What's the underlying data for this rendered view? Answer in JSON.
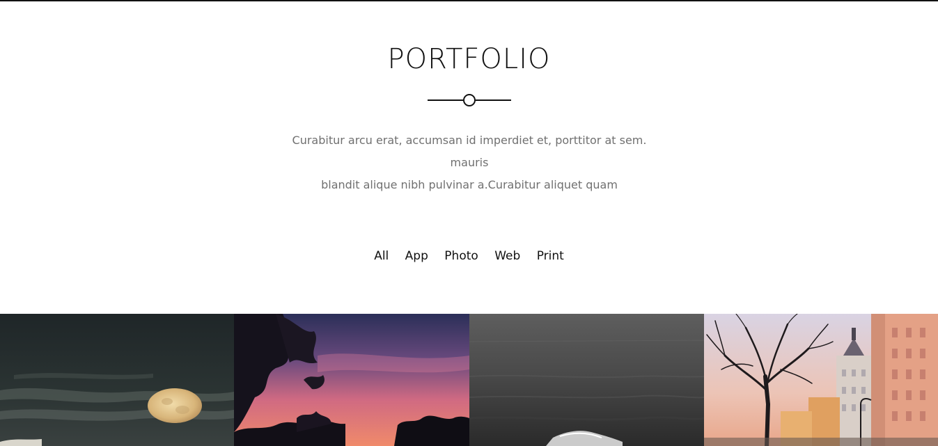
{
  "section": {
    "title": "PORTFOLIO",
    "description_line1": "Curabitur arcu erat, accumsan id imperdiet et, porttitor at sem. mauris",
    "description_line2": "blandit alique nibh pulvinar a.Curabitur aliquet quam"
  },
  "filters": [
    {
      "label": "All"
    },
    {
      "label": "App"
    },
    {
      "label": "Photo"
    },
    {
      "label": "Web"
    },
    {
      "label": "Print"
    }
  ],
  "gallery": [
    {
      "name": "full-moon-night"
    },
    {
      "name": "sunset-trees"
    },
    {
      "name": "grey-sea-wave"
    },
    {
      "name": "city-tree-buildings"
    }
  ],
  "colors": {
    "text": "#111111",
    "muted": "#707070"
  }
}
